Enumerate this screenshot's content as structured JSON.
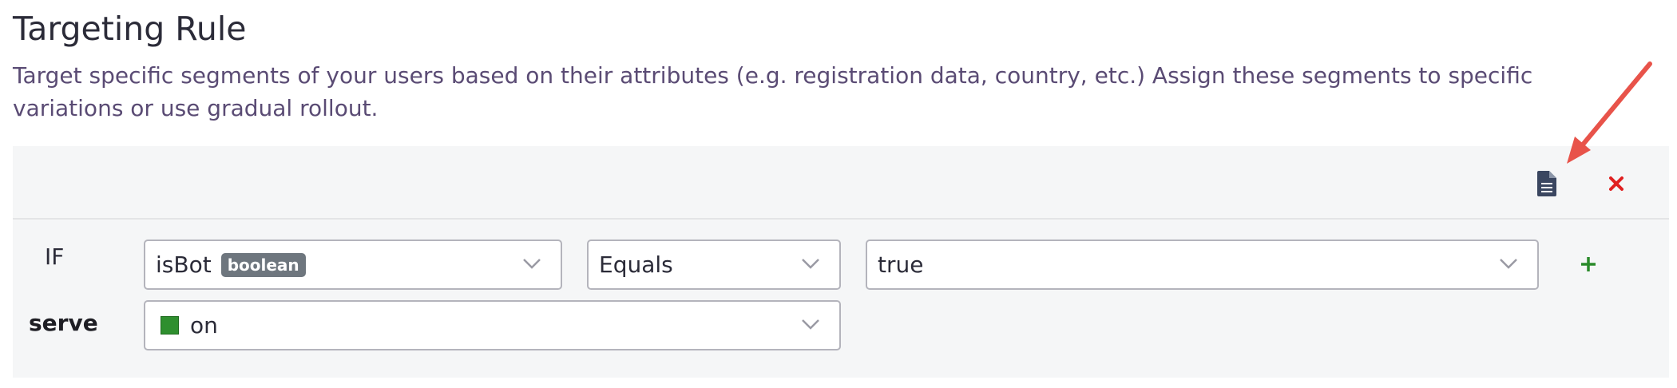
{
  "header": {
    "title": "Targeting Rule",
    "description": "Target specific segments of your users based on their attributes (e.g. registration data, country, etc.) Assign these segments to specific variations or use gradual rollout."
  },
  "rule": {
    "toolbar": {
      "doc_icon": "document-icon",
      "delete_icon": "close-icon",
      "delete_color": "#e02020"
    },
    "condition": {
      "if_label": "IF",
      "attribute": "isBot",
      "attribute_type": "boolean",
      "operator": "Equals",
      "value": "true",
      "add_icon": "plus-icon",
      "add_color": "#2a8a2a"
    },
    "serve": {
      "label": "serve",
      "variation": "on",
      "variation_color": "#2f8f2f"
    }
  },
  "annotation": {
    "arrow_color": "#e8534a"
  }
}
